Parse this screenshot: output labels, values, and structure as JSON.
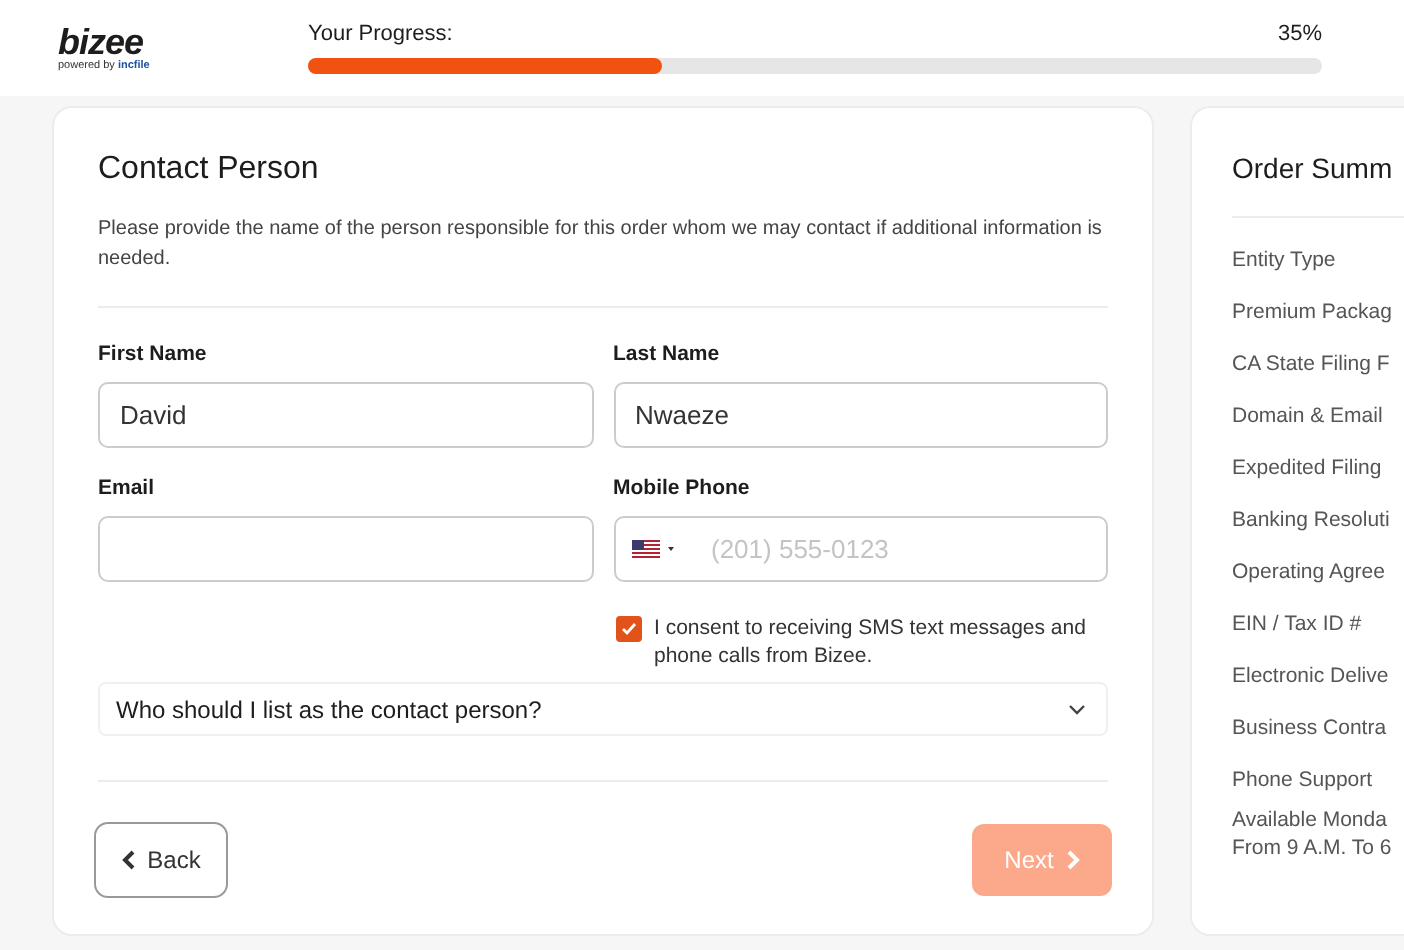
{
  "header": {
    "logo": "bizee",
    "powered_by": "powered by",
    "powered_brand": "incfile",
    "progress_label": "Your Progress:",
    "progress_reading": "35%",
    "level": 0.35
  },
  "contact": {
    "title": "Contact Person",
    "description": "Please provide the name of the person responsible for this order whom we may contact if additional information is needed.",
    "fields": [
      {
        "label": "First Name",
        "value": "David",
        "kind": "text"
      },
      {
        "label": "Last Name",
        "value": "Nwaeze",
        "kind": "text"
      },
      {
        "label": "Email",
        "kind": "text"
      },
      {
        "label": "Mobile Phone",
        "placeholder": "(201) 555-0123",
        "kind": "phone"
      }
    ],
    "consent": {
      "label": "I consent to receiving SMS text messages and phone calls from Bizee.",
      "checked": true
    },
    "faq": {
      "question": "Who should I list as the contact person?",
      "expanded": false
    },
    "back": "Back",
    "next": {
      "label": "Next",
      "disabled": true
    }
  },
  "summary": {
    "title": "Order Summ",
    "items": [
      "Entity Type",
      "Premium Packag",
      "CA State Filing F",
      "Domain & Email",
      "Expedited Filing",
      "Banking Resoluti",
      "Operating Agree",
      "EIN / Tax ID #",
      "Electronic Delive",
      "Business Contra",
      "Phone Support"
    ],
    "note": [
      "Available Monda",
      "From 9 A.M. To 6"
    ]
  }
}
